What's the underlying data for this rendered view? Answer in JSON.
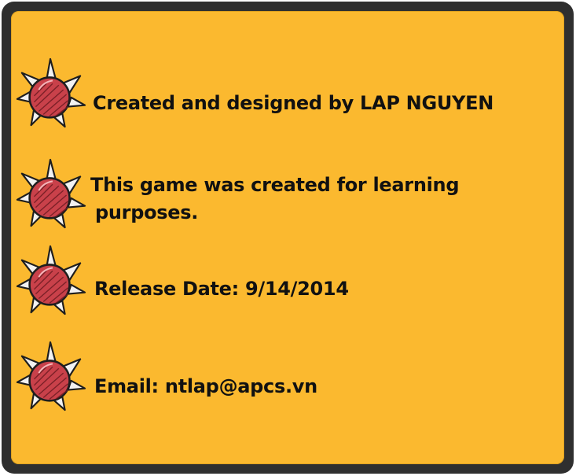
{
  "credits": [
    {
      "text": "Created and designed by LAP NGUYEN",
      "icon": "spiked-mine-icon"
    },
    {
      "text_line1": "This game was created for learning",
      "text_line2": "purposes.",
      "icon": "spiked-mine-icon"
    },
    {
      "text": "Release Date: 9/14/2014",
      "icon": "spiked-mine-icon"
    },
    {
      "text": "Email: ntlap@apcs.vn",
      "icon": "spiked-mine-icon"
    }
  ],
  "colors": {
    "panel_fill": "#fbb92f",
    "panel_border": "#2f2f2f",
    "mine_body": "#c9414a",
    "spike": "#f2f2f2",
    "text": "#111111"
  }
}
